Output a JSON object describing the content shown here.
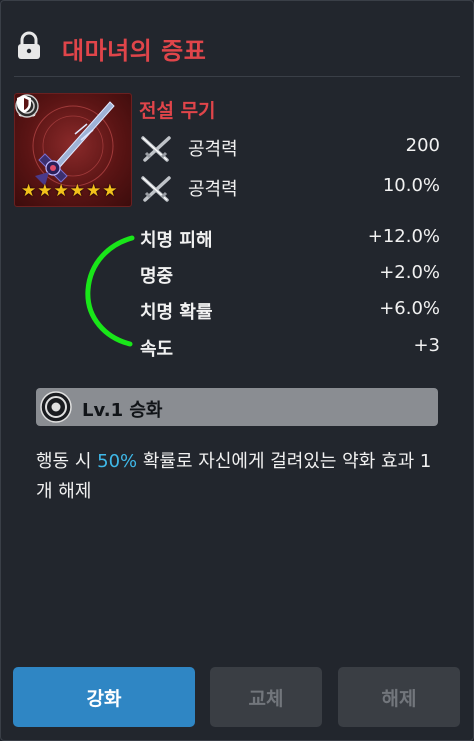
{
  "header": {
    "title": "대마녀의 증표",
    "lock_icon": "lock-icon"
  },
  "item": {
    "grade": "전설 무기",
    "stars": 6,
    "main_stats": [
      {
        "icon": "attack-swords-icon",
        "name": "공격력",
        "value": "200"
      },
      {
        "icon": "attack-swords-icon",
        "name": "공격력",
        "value": "10.0%"
      }
    ],
    "sub_stats": [
      {
        "name": "치명 피해",
        "value": "+12.0%"
      },
      {
        "name": "명중",
        "value": "+2.0%"
      },
      {
        "name": "치명 확률",
        "value": "+6.0%"
      },
      {
        "name": "속도",
        "value": "+3"
      }
    ],
    "thumbnail_icons": [
      "lock-icon",
      "ring-icon",
      "shield-icon",
      "star-icon"
    ]
  },
  "skill": {
    "level_label": "Lv.1 승화",
    "desc_before": "행동 시 ",
    "desc_highlight": "50%",
    "desc_after": " 확률로 자신에게 걸려있는 약화 효과 1개 해제",
    "highlight_color": "#3fb8e8"
  },
  "actions": {
    "enhance_label": "강화",
    "swap_label": "교체",
    "remove_label": "해제"
  },
  "colors": {
    "title_red": "#e0454a",
    "accent_blue": "#2f86c4",
    "annotation_green": "#19e619",
    "star_gold": "#f2c21b"
  }
}
